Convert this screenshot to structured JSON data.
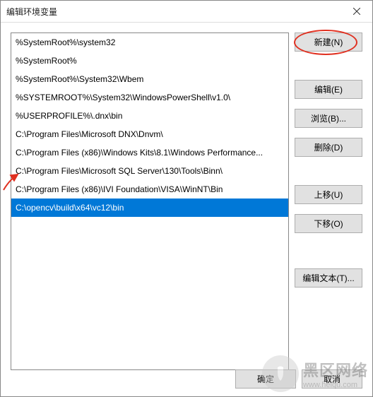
{
  "window": {
    "title": "编辑环境变量"
  },
  "list": {
    "items": [
      "%SystemRoot%\\system32",
      "%SystemRoot%",
      "%SystemRoot%\\System32\\Wbem",
      "%SYSTEMROOT%\\System32\\WindowsPowerShell\\v1.0\\",
      "%USERPROFILE%\\.dnx\\bin",
      "C:\\Program Files\\Microsoft DNX\\Dnvm\\",
      "C:\\Program Files (x86)\\Windows Kits\\8.1\\Windows Performance...",
      "C:\\Program Files\\Microsoft SQL Server\\130\\Tools\\Binn\\",
      "C:\\Program Files (x86)\\IVI Foundation\\VISA\\WinNT\\Bin",
      "C:\\opencv\\build\\x64\\vc12\\bin"
    ],
    "selected_index": 9
  },
  "buttons": {
    "new": "新建(N)",
    "edit": "编辑(E)",
    "browse": "浏览(B)...",
    "delete": "删除(D)",
    "move_up": "上移(U)",
    "move_down": "下移(O)",
    "edit_text": "编辑文本(T)...",
    "ok": "确定",
    "cancel": "取消"
  },
  "watermark": {
    "brand": "黑区网络",
    "url": "www.heiqu.com"
  }
}
